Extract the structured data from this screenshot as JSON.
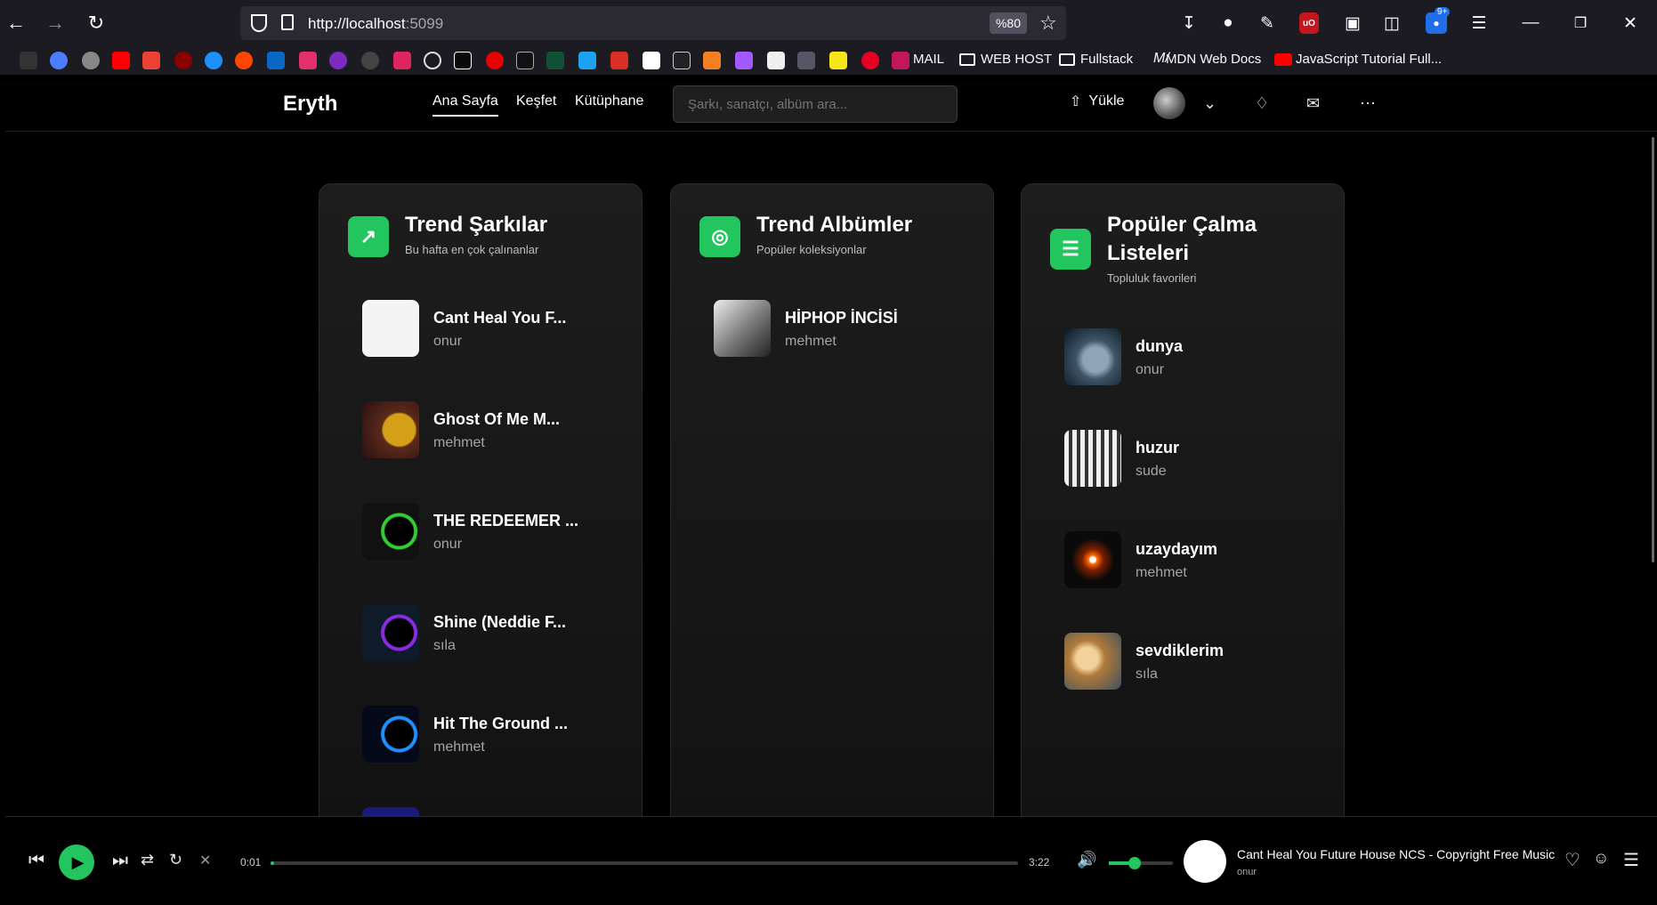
{
  "browser": {
    "url_prefix": "http://localhost",
    "url_port": ":5099",
    "zoom": "%80",
    "downloads_badge": "9+",
    "bookmarks": [
      "MAIL",
      "WEB HOST",
      "Fullstack",
      "MDN Web Docs",
      "JavaScript Tutorial Full..."
    ]
  },
  "app": {
    "logo": "Eryth",
    "nav": [
      "Ana Sayfa",
      "Keşfet",
      "Kütüphane"
    ],
    "search_placeholder": "Şarkı, sanatçı, albüm ara...",
    "upload_label": "Yükle"
  },
  "sections": {
    "songs": {
      "title": "Trend Şarkılar",
      "subtitle": "Bu hafta en çok çalınanlar",
      "items": [
        {
          "title": "Cant Heal You F...",
          "artist": "onur",
          "color": "#ffffff"
        },
        {
          "title": "Ghost Of Me M...",
          "artist": "mehmet",
          "color": "#d4a017"
        },
        {
          "title": "THE REDEEMER ...",
          "artist": "onur",
          "color": "#32cd32"
        },
        {
          "title": "Shine (Neddie F...",
          "artist": "sıla",
          "color": "#8a2be2"
        },
        {
          "title": "Hit The Ground ...",
          "artist": "mehmet",
          "color": "#1e90ff"
        }
      ]
    },
    "albums": {
      "title": "Trend Albümler",
      "subtitle": "Popüler koleksiyonlar",
      "items": [
        {
          "title": "HİPHOP İNCİSİ",
          "artist": "mehmet"
        }
      ]
    },
    "playlists": {
      "title": "Popüler Çalma Listeleri",
      "subtitle": "Topluluk favorileri",
      "items": [
        {
          "title": "dunya",
          "artist": "onur"
        },
        {
          "title": "huzur",
          "artist": "sude"
        },
        {
          "title": "uzaydayım",
          "artist": "mehmet"
        },
        {
          "title": "sevdiklerim",
          "artist": "sıla"
        }
      ]
    }
  },
  "player": {
    "current_time": "0:01",
    "duration": "3:22",
    "progress": 0.005,
    "volume": 0.4,
    "now_playing_title": "Cant Heal You Future House NCS - Copyright Free Music",
    "now_playing_artist": "onur",
    "accent": "#22c55e"
  }
}
